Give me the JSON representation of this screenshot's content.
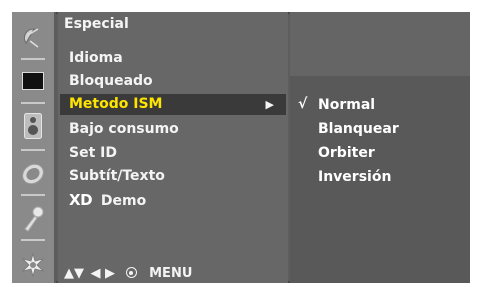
{
  "menu": {
    "title": "Especial",
    "items": [
      {
        "label": "Idioma"
      },
      {
        "label": "Bloqueado"
      },
      {
        "label": "Metodo ISM",
        "has_submenu": true
      },
      {
        "label": "Bajo consumo"
      },
      {
        "label": "Set ID"
      },
      {
        "label": "Subtít/Texto"
      },
      {
        "label": "Demo",
        "logo": "XD"
      }
    ],
    "selected_index": 2
  },
  "submenu": {
    "check_mark": "√",
    "options": [
      {
        "label": "Normal",
        "checked": true
      },
      {
        "label": "Blanquear"
      },
      {
        "label": "Orbiter"
      },
      {
        "label": "Inversión"
      }
    ]
  },
  "nav_hint": {
    "up_down": "▲▼",
    "left_right": "◀ ▶",
    "menu_label": "MENU"
  },
  "icons": [
    "satellite-dish-icon",
    "screen-icon",
    "speaker-icon",
    "clock-icon",
    "key-icon",
    "special-options-icon"
  ],
  "colors": {
    "highlight_text": "#ffe400",
    "panel": "#686767",
    "icon_strip": "#8a8a8a"
  }
}
